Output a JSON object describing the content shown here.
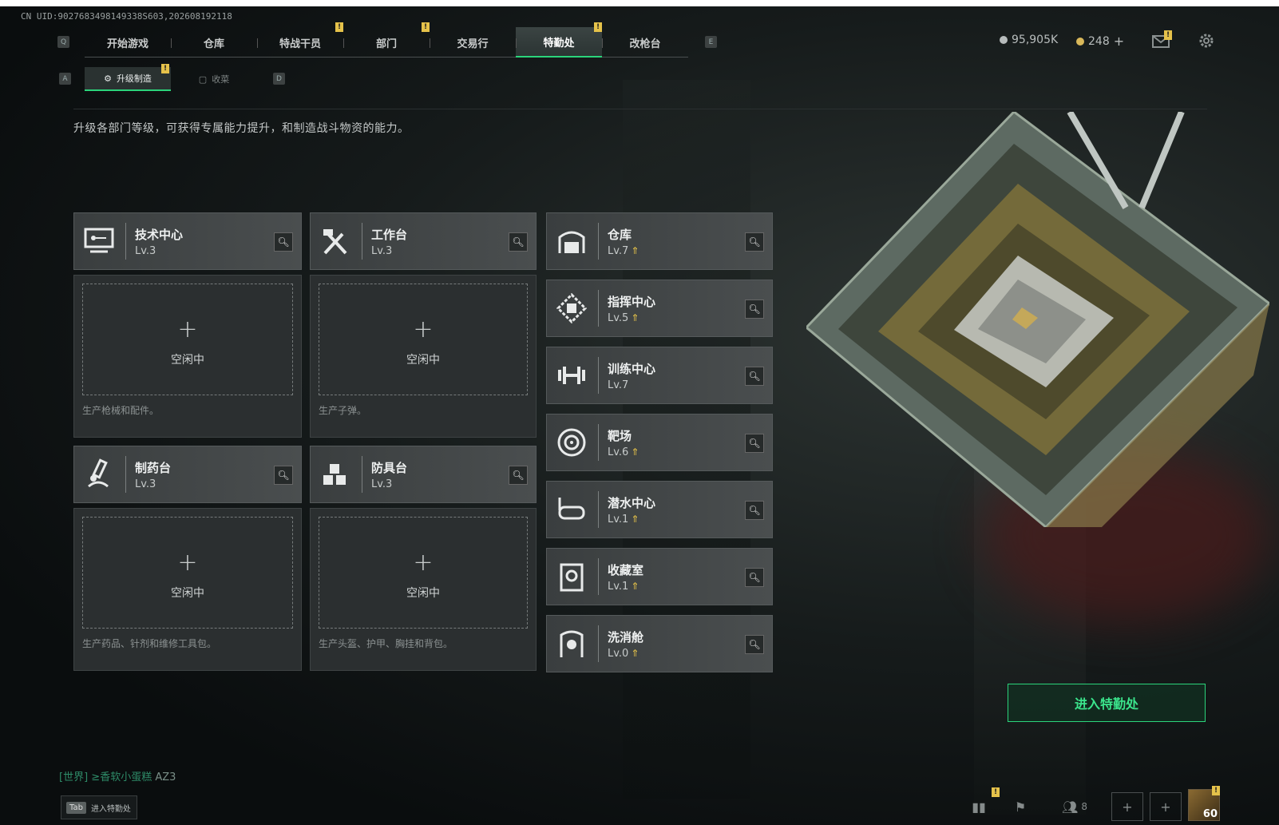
{
  "uid": "CN UID:9027683498149338S603,202608192118",
  "nav": {
    "left_key": "Q",
    "right_key": "E",
    "tabs": [
      {
        "label": "开始游戏",
        "badge": false
      },
      {
        "label": "仓库",
        "badge": false
      },
      {
        "label": "特战干员",
        "badge": true
      },
      {
        "label": "部门",
        "badge": true
      },
      {
        "label": "交易行",
        "badge": false
      },
      {
        "label": "特勤处",
        "badge": true,
        "active": true
      },
      {
        "label": "改枪台",
        "badge": false
      }
    ]
  },
  "subnav": {
    "left_key": "A",
    "right_key": "D",
    "tabs": [
      {
        "label": "升级制造",
        "active": true,
        "badge": true
      },
      {
        "label": "收菜",
        "active": false
      }
    ]
  },
  "currency": {
    "silver": "95,905K",
    "gold": "248"
  },
  "description": "升级各部门等级，可获得专属能力提升，和制造战斗物资的能力。",
  "stations": [
    {
      "name": "技术中心",
      "level": "Lv.3",
      "upgradable": false,
      "icon": "tech-center-icon",
      "slot_idle": "空闲中",
      "slot_note": "生产枪械和配件。"
    },
    {
      "name": "工作台",
      "level": "Lv.3",
      "upgradable": false,
      "icon": "workbench-icon",
      "slot_idle": "空闲中",
      "slot_note": "生产子弹。"
    },
    {
      "name": "制药台",
      "level": "Lv.3",
      "upgradable": false,
      "icon": "pharmacy-icon",
      "slot_idle": "空闲中",
      "slot_note": "生产药品、针剂和维修工具包。"
    },
    {
      "name": "防具台",
      "level": "Lv.3",
      "upgradable": false,
      "icon": "armor-bench-icon",
      "slot_idle": "空闲中",
      "slot_note": "生产头盔、护甲、胸挂和背包。"
    }
  ],
  "departments": [
    {
      "name": "仓库",
      "level": "Lv.7",
      "upgradable": true,
      "icon": "warehouse-icon"
    },
    {
      "name": "指挥中心",
      "level": "Lv.5",
      "upgradable": true,
      "icon": "command-center-icon"
    },
    {
      "name": "训练中心",
      "level": "Lv.7",
      "upgradable": false,
      "icon": "dumbbell-icon"
    },
    {
      "name": "靶场",
      "level": "Lv.6",
      "upgradable": true,
      "icon": "target-range-icon"
    },
    {
      "name": "潜水中心",
      "level": "Lv.1",
      "upgradable": true,
      "icon": "dive-mask-icon"
    },
    {
      "name": "收藏室",
      "level": "Lv.1",
      "upgradable": true,
      "icon": "collection-room-icon"
    },
    {
      "name": "洗消舱",
      "level": "Lv.0",
      "upgradable": true,
      "icon": "decon-pod-icon"
    }
  ],
  "enter_button": "进入特勤处",
  "chat": {
    "channel": "[世界]",
    "user": "≥香软小蛋糕",
    "message": "AZ3"
  },
  "tab_hint": {
    "key": "Tab",
    "label": "进入特勤处"
  },
  "bottom_bar": {
    "friends_count": "8",
    "player_level": "60"
  },
  "colors": {
    "accent_green": "#2bd47b",
    "badge_yellow": "#e5c24a",
    "card_bg": "#44494a"
  }
}
